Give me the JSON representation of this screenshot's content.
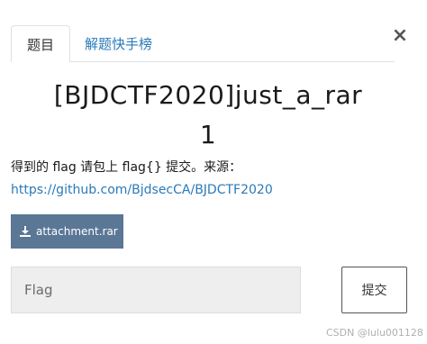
{
  "tabs": {
    "active_label": "题目",
    "inactive_label": "解题快手榜"
  },
  "close_symbol": "×",
  "challenge": {
    "title_line1": "[BJDCTF2020]just_a_rar",
    "title_line2": "1",
    "description_text": "得到的 flag 请包上 flag{} 提交。来源：",
    "description_link": "https://github.com/BjdsecCA/BJDCTF2020"
  },
  "attachment": {
    "label": "attachment.rar",
    "icon": "download-icon"
  },
  "flag_form": {
    "placeholder": "Flag",
    "value": "",
    "submit_label": "提交"
  },
  "watermark": "CSDN @lulu001128",
  "colors": {
    "link": "#2a7ab8",
    "attachment_bg": "#5a7796",
    "input_bg": "#eeeeee"
  }
}
